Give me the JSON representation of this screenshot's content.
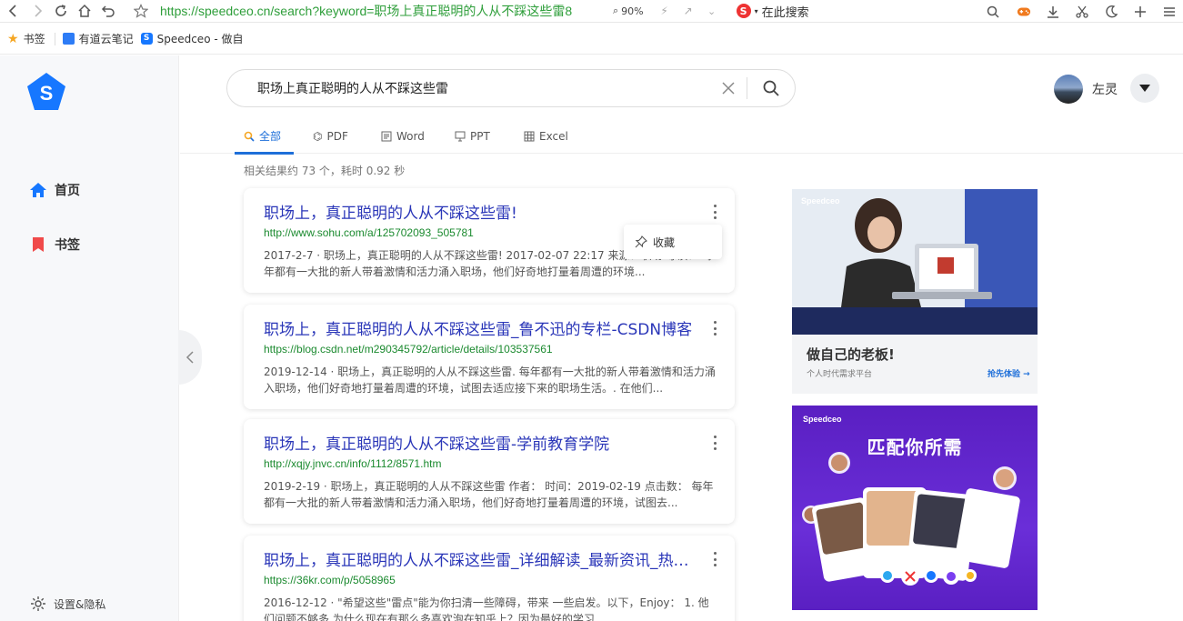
{
  "browser": {
    "url": "https://speedceo.cn/search?keyword=职场上真正聪明的人从不踩这些雷8",
    "zoom": "90%",
    "search_engine_label": "在此搜索"
  },
  "bookmarks": [
    {
      "label": "书签"
    },
    {
      "label": "有道云笔记"
    },
    {
      "label": "Speedceo - 做自"
    }
  ],
  "sidebar": {
    "items": [
      {
        "label": "首页"
      },
      {
        "label": "书签"
      }
    ],
    "settings_label": "设置&隐私"
  },
  "search": {
    "query": "职场上真正聪明的人从不踩这些雷"
  },
  "user": {
    "name": "左灵"
  },
  "tabs": [
    {
      "label": "全部",
      "active": true
    },
    {
      "label": "PDF"
    },
    {
      "label": "Word"
    },
    {
      "label": "PPT"
    },
    {
      "label": "Excel"
    }
  ],
  "results_stats": "相关结果约 73 个，耗时 0.92 秒",
  "results": [
    {
      "title": "职场上，真正聪明的人从不踩这些雷!",
      "url": "http://www.sohu.com/a/125702093_505781",
      "snippet": "2017-2-7 · 职场上，真正聪明的人从不踩这些雷!  2017-02-07 22:17 来源：职场 导读： 每年都有一大批的新人带着激情和活力涌入职场，他们好奇地打量着周遭的环境..."
    },
    {
      "title": "职场上，真正聪明的人从不踩这些雷_鲁不迅的专栏-CSDN博客",
      "url": "https://blog.csdn.net/m290345792/article/details/103537561",
      "snippet": "2019-12-14 · 职场上，真正聪明的人从不踩这些雷. 每年都有一大批的新人带着激情和活力涌入职场，他们好奇地打量着周遭的环境，试图去适应接下来的职场生活。. 在他们..."
    },
    {
      "title": "职场上，真正聪明的人从不踩这些雷-学前教育学院",
      "url": "http://xqjy.jnvc.cn/info/1112/8571.htm",
      "snippet": "2019-2-19 · 职场上，真正聪明的人从不踩这些雷 作者： 时间：2019-02-19 点击数： 每年都有一大批的新人带着激情和活力涌入职场，他们好奇地打量着周遭的环境，试图去..."
    },
    {
      "title": "职场上，真正聪明的人从不踩这些雷_详细解读_最新资讯_热点事件",
      "url": "https://36kr.com/p/5058965",
      "snippet": "2016-12-12 · \"希望这些\"雷点\"能为你扫清一些障碍，带来 一些启发。以下，Enjoy： 1. 他们问题不够多 为什么现在有那么多喜欢泡在知乎上？因为最好的学习 ..."
    }
  ],
  "popup": {
    "label": "收藏"
  },
  "ads": [
    {
      "brand": "Speedceo",
      "title": "做自己的老板!",
      "subtitle": "个人时代需求平台",
      "cta": "抢先体验 →"
    },
    {
      "brand": "Speedceo",
      "title": "匹配你所需"
    }
  ],
  "colors": {
    "accent": "#1e6fd9",
    "link": "#2a36b8",
    "url_green": "#1b8a2f",
    "ad_purple": "#6a2ed8"
  }
}
